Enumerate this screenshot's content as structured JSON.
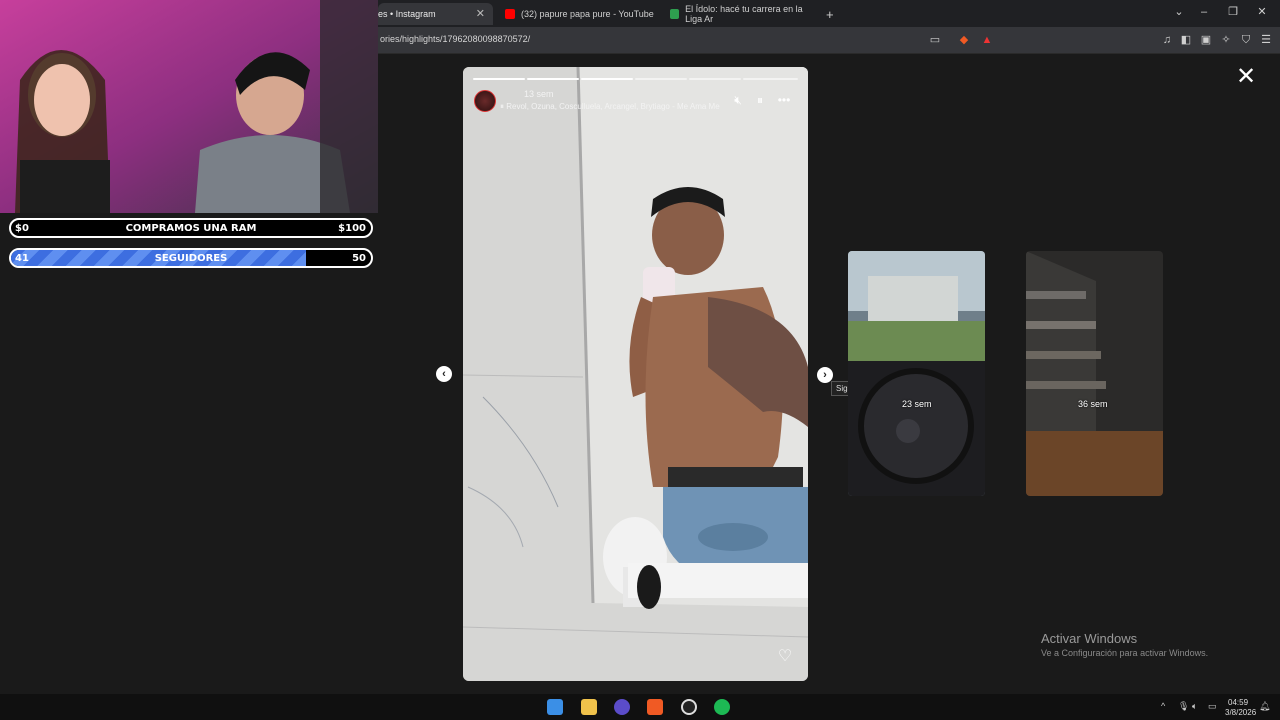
{
  "browser": {
    "tabs": [
      {
        "label": "es • Instagram",
        "active": true,
        "favicon_color": "#c13584"
      },
      {
        "label": "(32) papure papa pure - YouTube",
        "active": false,
        "favicon_color": "#ff0000"
      },
      {
        "label": "El Ídolo: hacé tu carrera en la Liga Ar",
        "active": false,
        "favicon_color": "#2e9e4f"
      }
    ],
    "new_tab": "+",
    "url": "ories/highlights/17962080098870572/"
  },
  "story": {
    "time_ago": "13 sem",
    "music": "Revol, Ozuna, Cosculluela, Arcangel, Brytiago - Me Ama Me",
    "progress_segments": 6,
    "progress_done": 3
  },
  "navigation": {
    "prev_icon": "chevron-left-icon",
    "next_icon": "chevron-right-icon",
    "tooltip": "Siguiente"
  },
  "previews": [
    {
      "time_ago": "23 sem"
    },
    {
      "time_ago": "36 sem"
    }
  ],
  "windows_activation": {
    "title": "Activar Windows",
    "subtitle": "Ve a Configuración para activar Windows."
  },
  "overlay": {
    "goal": {
      "left": "$0",
      "label": "COMPRAMOS UNA RAM",
      "right": "$100"
    },
    "followers": {
      "current": "41",
      "label": "SEGUIDORES",
      "target": "50",
      "fill_fraction": 0.82
    }
  },
  "taskbar": {
    "time": "04:59",
    "date": "3/8/2026"
  },
  "colors": {
    "follow_bar": "#3d6ee0",
    "page_bg": "#1a1a1a"
  }
}
